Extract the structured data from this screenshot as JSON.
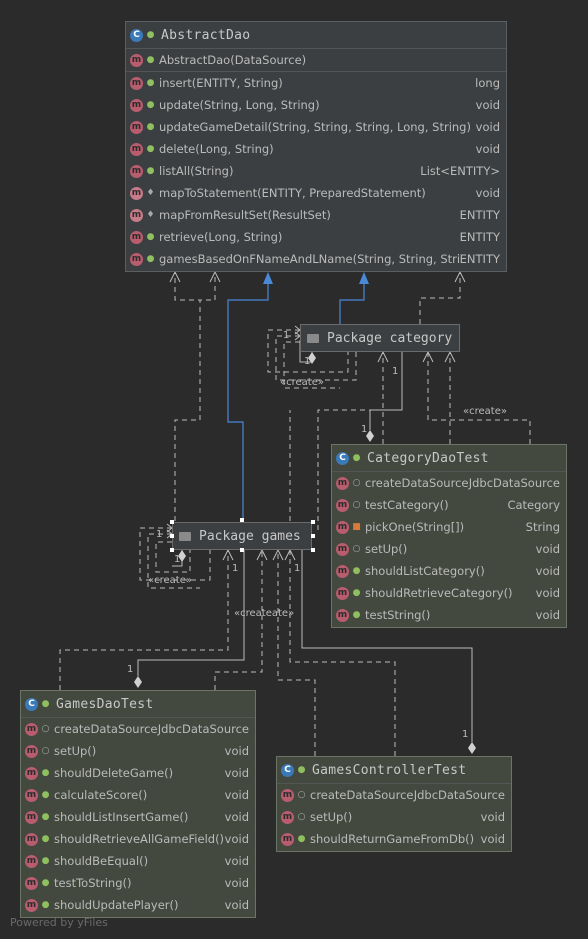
{
  "classes": {
    "abstract_dao": {
      "name": "AbstractDao",
      "constructor": "AbstractDao(DataSource)",
      "methods": [
        {
          "sig": "insert(ENTITY, String)",
          "ret": "long"
        },
        {
          "sig": "update(String, Long, String)",
          "ret": "void"
        },
        {
          "sig": "updateGameDetail(String, String, String, Long, String)",
          "ret": "void"
        },
        {
          "sig": "delete(Long, String)",
          "ret": "void"
        },
        {
          "sig": "listAll(String)",
          "ret": "List<ENTITY>"
        },
        {
          "sig": "mapToStatement(ENTITY, PreparedStatement)",
          "ret": "void"
        },
        {
          "sig": "mapFromResultSet(ResultSet)",
          "ret": "ENTITY"
        },
        {
          "sig": "retrieve(Long, String)",
          "ret": "ENTITY"
        },
        {
          "sig": "gamesBasedOnFNameAndLName(String, String, String)",
          "ret": "ENTITY"
        }
      ]
    },
    "category_dao_test": {
      "name": "CategoryDaoTest",
      "methods": [
        {
          "sig": "createDataSource()",
          "ret": "JdbcDataSource"
        },
        {
          "sig": "testCategory()",
          "ret": "Category"
        },
        {
          "sig": "pickOne(String[])",
          "ret": "String"
        },
        {
          "sig": "setUp()",
          "ret": "void"
        },
        {
          "sig": "shouldListCategory()",
          "ret": "void"
        },
        {
          "sig": "shouldRetrieveCategory()",
          "ret": "void"
        },
        {
          "sig": "testString()",
          "ret": "void"
        }
      ]
    },
    "games_dao_test": {
      "name": "GamesDaoTest",
      "methods": [
        {
          "sig": "createDataSource()",
          "ret": "JdbcDataSource"
        },
        {
          "sig": "setUp()",
          "ret": "void"
        },
        {
          "sig": "shouldDeleteGame()",
          "ret": "void"
        },
        {
          "sig": "calculateScore()",
          "ret": "void"
        },
        {
          "sig": "shouldListInsertGame()",
          "ret": "void"
        },
        {
          "sig": "shouldRetrieveAllGameField()",
          "ret": "void"
        },
        {
          "sig": "shouldBeEqual()",
          "ret": "void"
        },
        {
          "sig": "testToString()",
          "ret": "void"
        },
        {
          "sig": "shouldUpdatePlayer()",
          "ret": "void"
        }
      ]
    },
    "games_controller_test": {
      "name": "GamesControllerTest",
      "methods": [
        {
          "sig": "createDataSource()",
          "ret": "JdbcDataSource"
        },
        {
          "sig": "setUp()",
          "ret": "void"
        },
        {
          "sig": "shouldReturnGameFromDb()",
          "ret": "void"
        }
      ]
    }
  },
  "packages": {
    "category": "Package category",
    "games": "Package games"
  },
  "edge_labels": {
    "create": "«create»",
    "create_overlap": "«createate»",
    "one": "1"
  },
  "watermark": "Powered by yFiles",
  "colors": {
    "background": "#2b2b2b",
    "class_bg": "#3c3f41",
    "test_bg": "#43493f",
    "realization_arrow": "#4a88d8",
    "edge": "#bbbbbb"
  }
}
